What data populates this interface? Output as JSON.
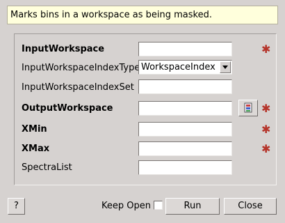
{
  "description": "Marks bins in a workspace as being masked.",
  "form": {
    "input_workspace": {
      "label": "InputWorkspace",
      "value": ""
    },
    "input_workspace_index_type": {
      "label": "InputWorkspaceIndexType",
      "value": "WorkspaceIndex"
    },
    "input_workspace_index_set": {
      "label": "InputWorkspaceIndexSet",
      "value": ""
    },
    "output_workspace": {
      "label": "OutputWorkspace",
      "value": ""
    },
    "xmin": {
      "label": "XMin",
      "value": ""
    },
    "xmax": {
      "label": "XMax",
      "value": ""
    },
    "spectra_list": {
      "label": "SpectraList",
      "value": ""
    }
  },
  "required_marker": "*",
  "footer": {
    "help_label": "?",
    "keep_open_label": "Keep Open",
    "keep_open_checked": false,
    "run_label": "Run",
    "close_label": "Close"
  },
  "icons": {
    "required": "star-icon",
    "browse": "workspace-browse-icon",
    "dropdown": "chevron-down-icon"
  },
  "colors": {
    "required_star": "#b5342a",
    "description_bg": "#ffffdc",
    "window_bg": "#d6d2d0"
  }
}
